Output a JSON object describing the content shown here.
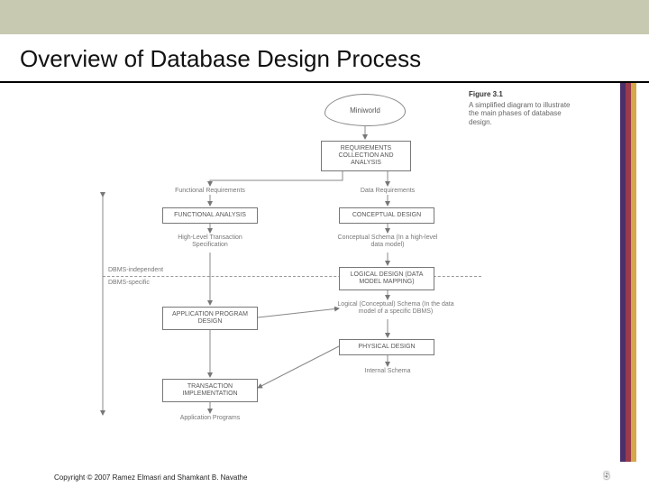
{
  "slide": {
    "title": "Overview of Database Design Process",
    "footer": "Copyright © 2007 Ramez Elmasri and Shamkant B. Navathe",
    "page_number": "5"
  },
  "figure": {
    "number": "Figure 3.1",
    "caption": "A simplified diagram to illustrate the main phases of database design.",
    "nodes": {
      "miniworld": "Miniworld",
      "requirements": "REQUIREMENTS COLLECTION AND ANALYSIS",
      "func_req": "Functional Requirements",
      "data_req": "Data Requirements",
      "func_analysis": "FUNCTIONAL ANALYSIS",
      "conceptual_design": "CONCEPTUAL DESIGN",
      "hltx": "High-Level Transaction Specification",
      "conceptual_schema": "Conceptual Schema (In a high-level data model)",
      "dbms_independent": "DBMS-independent",
      "dbms_specific": "DBMS-specific",
      "logical_design": "LOGICAL DESIGN (DATA MODEL MAPPING)",
      "app_prog_design": "APPLICATION PROGRAM DESIGN",
      "logical_schema": "Logical (Conceptual) Schema (In the data model of a specific DBMS)",
      "physical_design": "PHYSICAL DESIGN",
      "tx_impl": "TRANSACTION IMPLEMENTATION",
      "internal_schema": "Internal Schema",
      "app_programs": "Application Programs"
    }
  }
}
